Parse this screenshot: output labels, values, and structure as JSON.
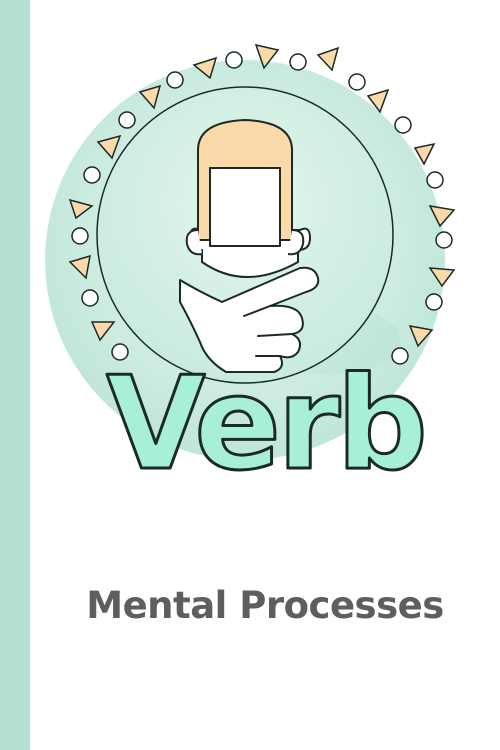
{
  "cover": {
    "title": "Verb",
    "subtitle": "Mental Processes"
  },
  "colors": {
    "stripe": "#b5dfcf",
    "mint_fill": "#a7efd7",
    "watercolor": "#cfeee3",
    "outline": "#1b2a26",
    "hair": "#fbd9a9",
    "subtitle_text": "#5e5e5e"
  },
  "icons": [
    "thinking-head-icon",
    "thinking-hand-icon"
  ]
}
